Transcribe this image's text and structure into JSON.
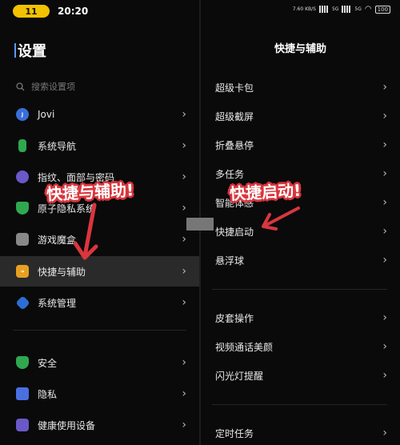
{
  "status": {
    "battery": "11",
    "time": "20:20",
    "speed": "7.60 KB/S",
    "signal_a": "5G",
    "signal_b": "5G",
    "battery_level": "100"
  },
  "left": {
    "title": "设置",
    "search_placeholder": "搜索设置项",
    "items": [
      {
        "label": "Jovi",
        "icon": "jovi-icon",
        "color": "#3a6fd8"
      },
      {
        "label": "系统导航",
        "icon": "navigation-icon",
        "color": "#2fa84f"
      },
      {
        "label": "指纹、面部与密码",
        "icon": "fingerprint-icon",
        "color": "#6b58c9"
      },
      {
        "label": "原子隐私系统",
        "icon": "privacy-icon",
        "color": "#2fa84f"
      },
      {
        "label": "游戏魔盒",
        "icon": "game-icon",
        "color": "#888888"
      },
      {
        "label": "快捷与辅助",
        "icon": "shortcut-icon",
        "color": "#e8a020"
      },
      {
        "label": "系统管理",
        "icon": "system-icon",
        "color": "#2b6fd6"
      },
      {
        "label": "安全",
        "icon": "security-icon",
        "color": "#2fa84f"
      },
      {
        "label": "隐私",
        "icon": "lock-icon",
        "color": "#4a6fe0"
      },
      {
        "label": "健康使用设备",
        "icon": "health-icon",
        "color": "#6b58c9"
      }
    ],
    "overlay": "快捷与辅助!"
  },
  "right": {
    "title": "快捷与辅助",
    "items": [
      "超级卡包",
      "超级截屏",
      "折叠悬停",
      "多任务",
      "智能体感",
      "快捷启动",
      "悬浮球",
      "皮套操作",
      "视频通话美颜",
      "闪光灯提醒",
      "定时任务"
    ],
    "overlay": "快捷启动!"
  },
  "accent_red": "#d9363e"
}
